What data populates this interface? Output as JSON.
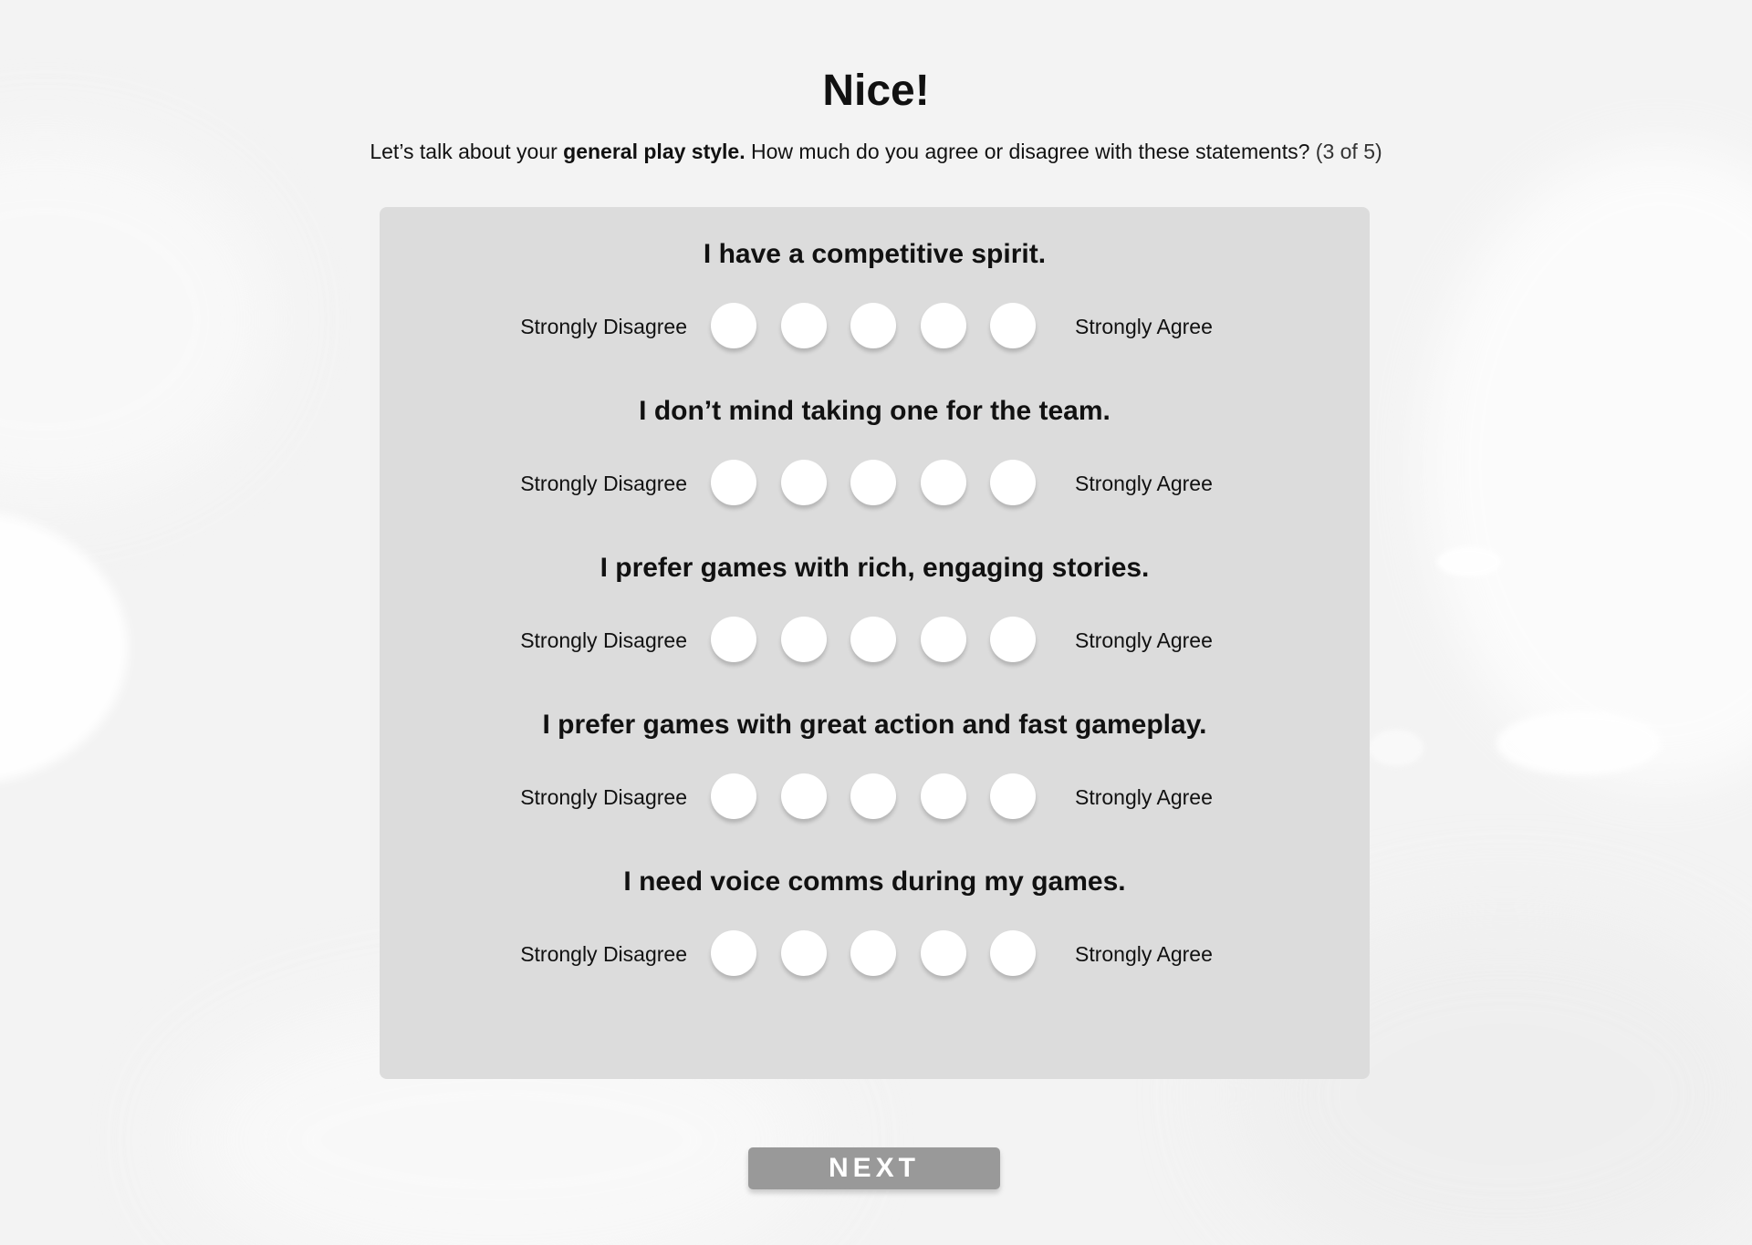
{
  "header": {
    "title": "Nice!",
    "subtitle_prefix": "Let’s talk about your ",
    "subtitle_bold": "general play style.",
    "subtitle_suffix": " How much do you agree or disagree with these statements? ",
    "progress": "(3 of 5)"
  },
  "scale": {
    "left_label": "Strongly Disagree",
    "right_label": "Strongly Agree",
    "options_count": 5
  },
  "questions": [
    {
      "statement": "I have a competitive spirit.",
      "selected": null
    },
    {
      "statement": "I don’t mind taking one for the team.",
      "selected": null
    },
    {
      "statement": "I prefer games with rich, engaging stories.",
      "selected": null
    },
    {
      "statement": "I prefer games with great action and fast gameplay.",
      "selected": null
    },
    {
      "statement": "I need voice comms during my games.",
      "selected": null
    }
  ],
  "footer": {
    "next_label": "NEXT"
  },
  "colors": {
    "background": "#f3f3f3",
    "panel": "#dcdcdc",
    "radio": "#ffffff",
    "button": "#999999",
    "button_text": "#ffffff",
    "text": "#111111"
  }
}
